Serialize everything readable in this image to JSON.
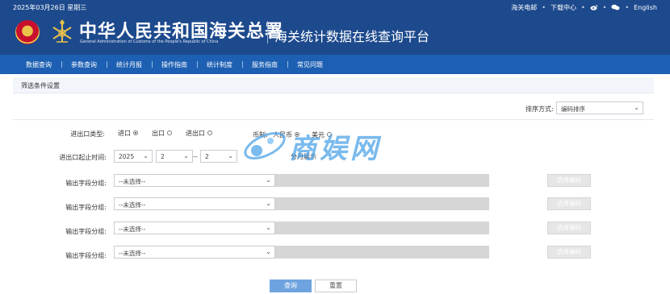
{
  "header": {
    "date": "2025年03月26日 星期三",
    "links": [
      "海关电邮",
      "下载中心",
      "English"
    ],
    "separator": "•",
    "cn_name": "中华人民共和国海关总署",
    "en_name": "General Administration of Customs of the People's Republic of China",
    "platform": "海关统计数据在线查询平台"
  },
  "nav": [
    "数据查询",
    "参数查询",
    "统计月报",
    "操作指南",
    "统计制度",
    "服务指南",
    "常见问题"
  ],
  "filter": {
    "title": "筛选条件设置",
    "sort_label": "排序方式:",
    "sort_value": "编码排序",
    "trade_type_label": "进出口类型:",
    "trade_types": [
      {
        "label": "进口",
        "checked": true
      },
      {
        "label": "出口",
        "checked": false
      },
      {
        "label": "进出口",
        "checked": false
      }
    ],
    "currency_label": "币制:",
    "currencies": [
      {
        "label": "人民币",
        "checked": true
      },
      {
        "label": "美元",
        "checked": false
      }
    ],
    "period_label": "进出口起止时间:",
    "year": "2025",
    "month_from": "2",
    "dash": "--",
    "month_to": "2",
    "monthly_label": "分月展示",
    "field_label": "输出字段分组:",
    "field_placeholder": "--未选择--",
    "code_button": "选择编码",
    "query_button": "查询",
    "reset_button": "重置"
  },
  "watermark": "商娱网",
  "colors": {
    "header": "#1d4a8d",
    "nav": "#1d60b3",
    "query": "#6fa3df",
    "grey": "#d6d6d6"
  }
}
